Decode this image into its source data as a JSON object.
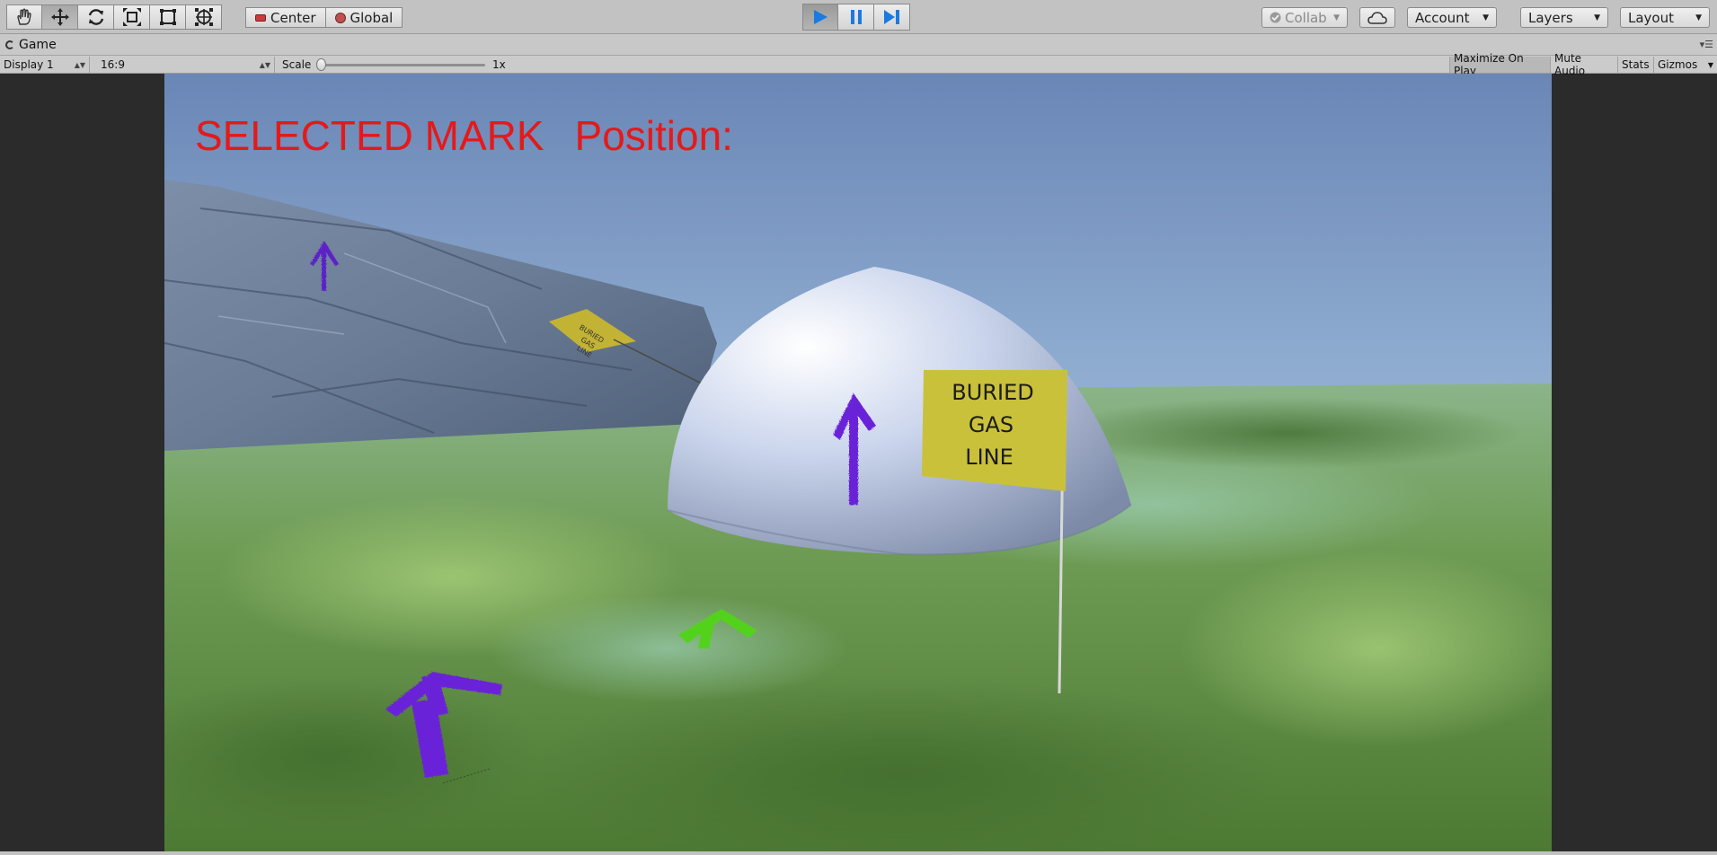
{
  "toolbar": {
    "tools": [
      {
        "name": "hand-tool",
        "active": false
      },
      {
        "name": "move-tool",
        "active": true
      },
      {
        "name": "rotate-tool",
        "active": false
      },
      {
        "name": "scale-tool",
        "active": false
      },
      {
        "name": "rect-tool",
        "active": false
      },
      {
        "name": "transform-tool",
        "active": false
      }
    ],
    "pivot_label": "Center",
    "rotation_label": "Global",
    "play_state": {
      "playing": true,
      "paused": false
    },
    "collab_label": "Collab",
    "account_label": "Account",
    "layers_label": "Layers",
    "layout_label": "Layout"
  },
  "tab": {
    "title": "Game"
  },
  "gamebar": {
    "display": "Display 1",
    "aspect": "16:9",
    "scale_label": "Scale",
    "scale_value": "1x",
    "maximize_on_play": "Maximize On Play",
    "mute_audio": "Mute Audio",
    "stats": "Stats",
    "gizmos": "Gizmos"
  },
  "game": {
    "hud_title": "SELECTED MARK",
    "hud_position_label": "Position:",
    "flag_big": [
      "BURIED",
      "GAS",
      "LINE"
    ],
    "flag_small": [
      "BURIED",
      "GAS",
      "LINE"
    ]
  },
  "colors": {
    "hud_text": "#e41a1a",
    "arrow_purple": "#6a22d8",
    "arrow_green": "#52d21c",
    "flag_yellow": "#c9c13a",
    "play_blue": "#1a7ae0"
  }
}
